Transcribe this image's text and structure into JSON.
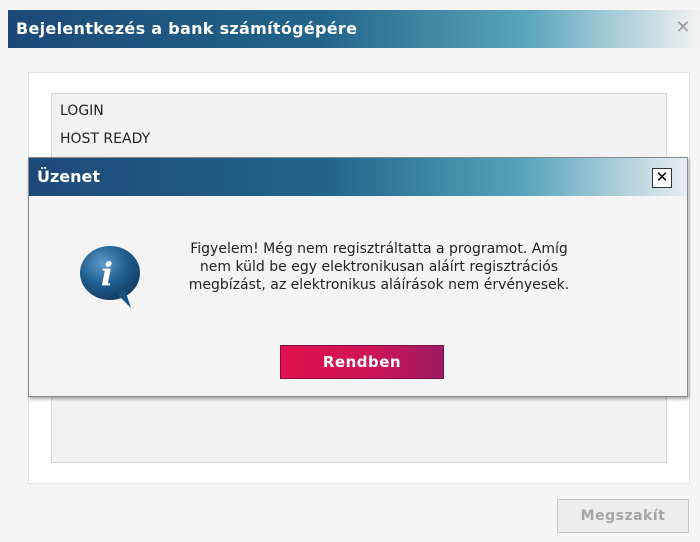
{
  "main_window": {
    "title": "Bejelentkezés a bank számítógépére",
    "close_glyph": "✕",
    "log_lines": [
      "LOGIN",
      "HOST READY"
    ],
    "cancel_label": "Megszakít"
  },
  "dialog": {
    "title": "Üzenet",
    "close_glyph": "✕",
    "icon": "info-speech-bubble-icon",
    "message_lines": [
      "Figyelem! Még nem regisztráltatta a programot. Amíg",
      "nem küld be egy elektronikusan aláírt regisztrációs",
      "megbízást, az elektronikus aláírások nem érvényesek."
    ],
    "ok_label": "Rendben"
  },
  "colors": {
    "titlebar_dark": "#1c4a78",
    "titlebar_mid": "#22648a",
    "ok_button_start": "#e0114e",
    "ok_button_end": "#9c1b63",
    "icon_blue": "#1f5f91"
  }
}
